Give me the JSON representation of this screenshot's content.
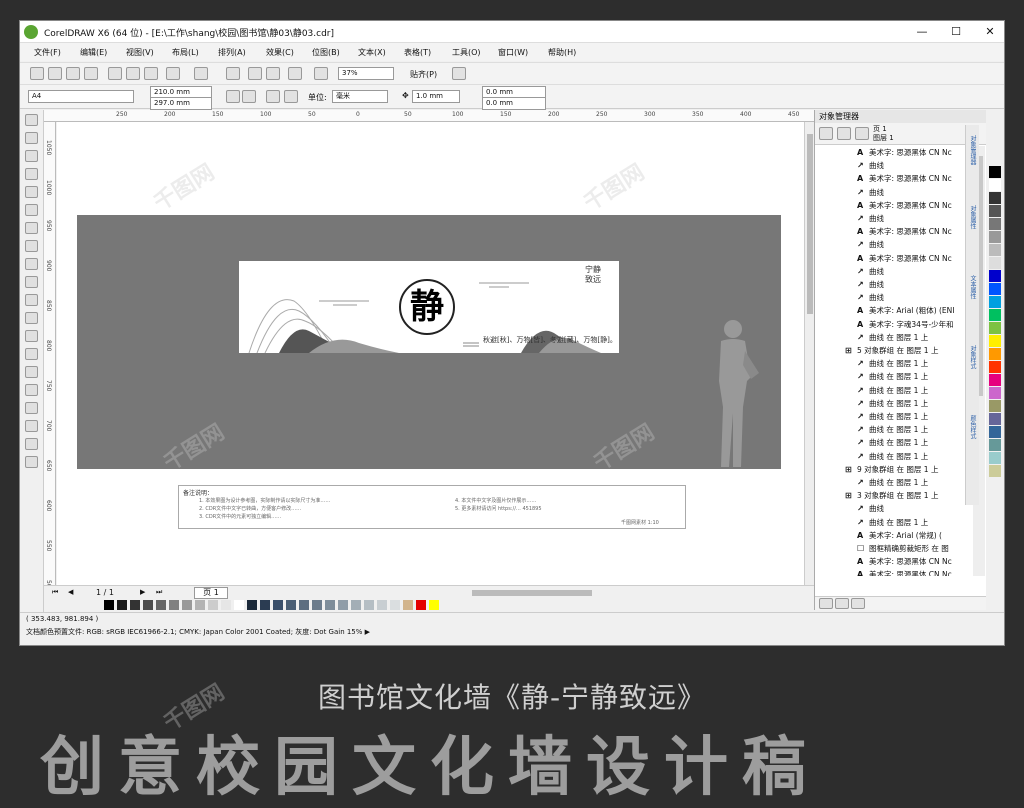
{
  "window": {
    "title": "CorelDRAW X6 (64 位) - [E:\\工作\\shang\\校园\\图书馆\\静03\\静03.cdr]",
    "controls": [
      "—",
      "☐",
      "✕"
    ]
  },
  "menu": [
    "文件(F)",
    "编辑(E)",
    "视图(V)",
    "布局(L)",
    "排列(A)",
    "效果(C)",
    "位图(B)",
    "文本(X)",
    "表格(T)",
    "工具(O)",
    "窗口(W)",
    "帮助(H)"
  ],
  "toolbar": {
    "zoom": "37%",
    "snap": "贴齐(P)"
  },
  "property_bar": {
    "page_size": "A4",
    "width": "210.0 mm",
    "height": "297.0 mm",
    "unit_label": "单位:",
    "unit": "毫米",
    "nudge": "1.0 mm",
    "dup_x": "0.0 mm",
    "dup_y": "0.0 mm"
  },
  "ruler": {
    "h_ticks": [
      "250",
      "200",
      "150",
      "100",
      "50",
      "0",
      "50",
      "100",
      "150",
      "200",
      "250",
      "300",
      "350",
      "400",
      "450",
      "500",
      "550"
    ],
    "v_ticks": [
      "1050",
      "1000",
      "950",
      "900",
      "850",
      "800",
      "750",
      "700",
      "650",
      "600",
      "550",
      "500"
    ]
  },
  "artwork": {
    "seal_char": "静",
    "vertical_text": "宁静致远",
    "poem": "秋避[秋]、万物[皆]、冬避[藏]、万物[静]。",
    "notes_title": "备注说明：",
    "notes_left": [
      "1. 本效果图为设计参考图，实际制作请以实际尺寸为准……",
      "2. CDR文件中文字已转曲，方便客户修改……",
      "3. CDR文件中的元素可独立编辑……"
    ],
    "notes_right": [
      "4. 本文件中文字及图片仅作展示……",
      "5. 更多素材请访问 https://… 451895"
    ],
    "notes_footer": "千图网素材 1:10"
  },
  "navigator": {
    "page_count": "1 / 1",
    "page_tab": "页 1"
  },
  "status": {
    "coords": "( 353.483, 981.894 )",
    "color_profile": "文档颜色预置文件: RGB: sRGB IEC61966-2.1; CMYK: Japan Color 2001 Coated; 灰度: Dot Gain 15% ▶"
  },
  "docker": {
    "title": "对象管理器",
    "page_label": "页 1",
    "layer_label": "图层 1",
    "items": [
      {
        "icon": "A",
        "label": "美术字: 思源黑体 CN Nc"
      },
      {
        "icon": "↗",
        "label": "曲线"
      },
      {
        "icon": "A",
        "label": "美术字: 思源黑体 CN Nc"
      },
      {
        "icon": "↗",
        "label": "曲线"
      },
      {
        "icon": "A",
        "label": "美术字: 思源黑体 CN Nc"
      },
      {
        "icon": "↗",
        "label": "曲线"
      },
      {
        "icon": "A",
        "label": "美术字: 思源黑体 CN Nc"
      },
      {
        "icon": "↗",
        "label": "曲线"
      },
      {
        "icon": "A",
        "label": "美术字: 思源黑体 CN Nc"
      },
      {
        "icon": "↗",
        "label": "曲线"
      },
      {
        "icon": "↗",
        "label": "曲线"
      },
      {
        "icon": "↗",
        "label": "曲线"
      },
      {
        "icon": "A",
        "label": "美术字: Arial (粗体) (ENI"
      },
      {
        "icon": "A",
        "label": "美术字: 字魂34号-少年和"
      },
      {
        "icon": "↗",
        "label": "曲线 在 图层 1 上"
      },
      {
        "icon": "⊞",
        "label": "5 对象群组 在 图层 1 上"
      },
      {
        "icon": "↗",
        "label": "曲线 在 图层 1 上"
      },
      {
        "icon": "↗",
        "label": "曲线 在 图层 1 上"
      },
      {
        "icon": "↗",
        "label": "曲线 在 图层 1 上"
      },
      {
        "icon": "↗",
        "label": "曲线 在 图层 1 上"
      },
      {
        "icon": "↗",
        "label": "曲线 在 图层 1 上"
      },
      {
        "icon": "↗",
        "label": "曲线 在 图层 1 上"
      },
      {
        "icon": "↗",
        "label": "曲线 在 图层 1 上"
      },
      {
        "icon": "↗",
        "label": "曲线 在 图层 1 上"
      },
      {
        "icon": "⊞",
        "label": "9 对象群组 在 图层 1 上"
      },
      {
        "icon": "↗",
        "label": "曲线 在 图层 1 上"
      },
      {
        "icon": "⊞",
        "label": "3 对象群组 在 图层 1 上"
      },
      {
        "icon": "↗",
        "label": "曲线"
      },
      {
        "icon": "↗",
        "label": "曲线 在 图层 1 上"
      },
      {
        "icon": "A",
        "label": "美术字: Arial (常规) ("
      },
      {
        "icon": "☐",
        "label": "图框精确剪裁矩形 在 图"
      },
      {
        "icon": "A",
        "label": "美术字: 思源黑体 CN Nc"
      },
      {
        "icon": "A",
        "label": "美术字: 思源黑体 CN Nc"
      }
    ],
    "side_tabs": [
      "对象管理器",
      "对象属性",
      "文本属性",
      "对象样式",
      "颜色样式"
    ]
  },
  "palette": [
    "#000000",
    "#1a1a1a",
    "#333333",
    "#4d4d4d",
    "#666666",
    "#808080",
    "#999999",
    "#b3b3b3",
    "#cccccc",
    "#e6e6e6",
    "#ffffff",
    "#1c2a3a",
    "#2b3c52",
    "#3a4f6a",
    "#4a5e74",
    "#5d6e80",
    "#6c7c8c",
    "#7e8d9a",
    "#909da8",
    "#a3aeb6",
    "#b5bec4",
    "#c8ced2",
    "#dadee0",
    "#d2b48c",
    "#e40000",
    "#ffff00"
  ],
  "right_palette": [
    "#000000",
    "#ffffff",
    "#333333",
    "#555555",
    "#777777",
    "#999999",
    "#bbbbbb",
    "#dddddd",
    "#0000cc",
    "#0055ff",
    "#00a0e0",
    "#00c060",
    "#7dc242",
    "#ffee00",
    "#ff9900",
    "#ff3300",
    "#e6007e",
    "#cc66cc",
    "#999966",
    "#666699",
    "#336699",
    "#669999",
    "#99cccc",
    "#cccc99"
  ],
  "caption": "图书馆文化墙《静-宁静致远》",
  "big_title": "创意校园文化墙设计稿",
  "watermark": "千图网"
}
